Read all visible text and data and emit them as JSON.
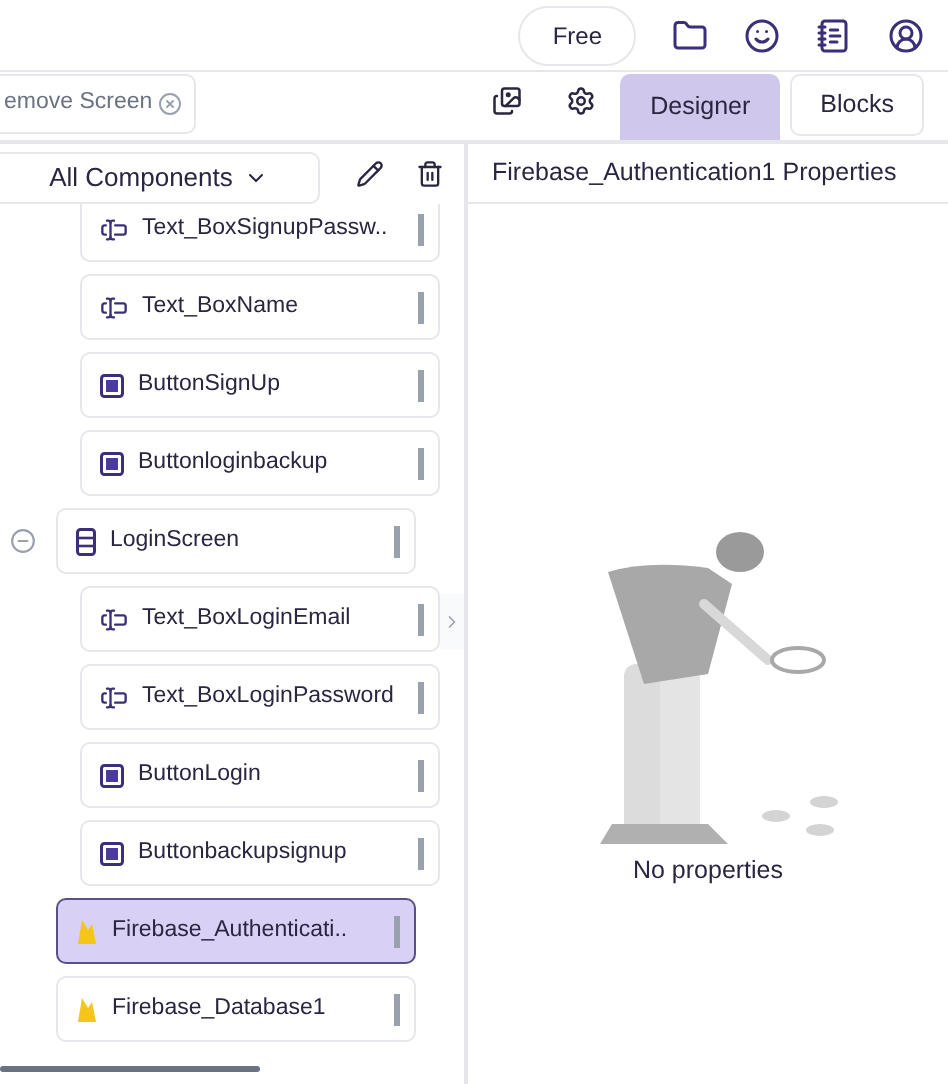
{
  "top_bar": {
    "plan_badge": "Free"
  },
  "toolbar": {
    "remove_screen": "emove Screen",
    "tabs": [
      {
        "label": "Designer",
        "selected": true
      },
      {
        "label": "Blocks",
        "selected": false
      }
    ]
  },
  "components_panel": {
    "filter": "All Components",
    "tree": [
      {
        "children": [
          {
            "label": "Text_BoxSignupPassw..",
            "kind": "textbox",
            "selected": false
          },
          {
            "label": "Text_BoxName",
            "kind": "textbox",
            "selected": false
          },
          {
            "label": "ButtonSignUp",
            "kind": "button",
            "selected": false
          },
          {
            "label": "Buttonloginbackup",
            "kind": "button",
            "selected": false
          }
        ]
      },
      {
        "label": "LoginScreen",
        "kind": "screen",
        "selected": false,
        "expanded": true,
        "children": [
          {
            "label": "Text_BoxLoginEmail",
            "kind": "textbox",
            "selected": false
          },
          {
            "label": "Text_BoxLoginPassword",
            "kind": "textbox",
            "selected": false
          },
          {
            "label": "ButtonLogin",
            "kind": "button",
            "selected": false
          },
          {
            "label": "Buttonbackupsignup",
            "kind": "button",
            "selected": false
          }
        ]
      },
      {
        "label": "Firebase_Authenticati..",
        "kind": "firebase",
        "selected": true
      },
      {
        "label": "Firebase_Database1",
        "kind": "firebase",
        "selected": false
      }
    ]
  },
  "properties_panel": {
    "title": "Firebase_Authentication1 Properties",
    "empty_message": "No properties"
  }
}
